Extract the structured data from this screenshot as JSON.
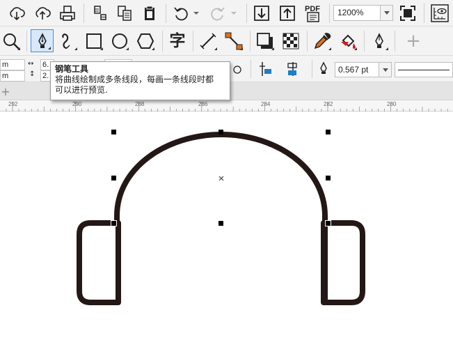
{
  "toolbar_top": {
    "buttons": [
      {
        "name": "import-icon"
      },
      {
        "name": "upload-cloud-icon"
      },
      {
        "name": "print-icon"
      },
      {
        "name": "cut-icon"
      },
      {
        "name": "copy-icon"
      },
      {
        "name": "paste-icon"
      },
      {
        "name": "undo-icon"
      },
      {
        "name": "redo-icon"
      },
      {
        "name": "import-arrow-icon"
      },
      {
        "name": "export-arrow-icon"
      }
    ],
    "pdf_label": "PDF",
    "zoom_value": "1200%"
  },
  "toolbox": {
    "active_tool": "pen-tool",
    "plus_label": "+",
    "text_tool_glyph": "字"
  },
  "property_bar": {
    "unit_top": "m",
    "unit_bottom": "m",
    "width_value": "6.",
    "height_value": "2.",
    "outline_width": "0.567 pt"
  },
  "tooltip": {
    "title": "钢笔工具",
    "desc_line1": "将曲线绘制成多条线段，每画一条线段时都",
    "desc_line2": "可以进行预览."
  },
  "tabstrip": {
    "add_label": "+"
  },
  "ruler": {
    "labels": [
      "292",
      "290",
      "288",
      "286",
      "284",
      "282",
      "280"
    ]
  },
  "colors": {
    "stroke": "#231815",
    "accent_orange": "#e0701c",
    "accent_blue": "#1c7fc7",
    "accent_red": "#d71920"
  }
}
